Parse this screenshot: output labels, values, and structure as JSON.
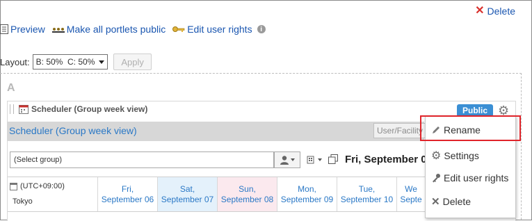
{
  "top_actions": {
    "delete_label": "Delete"
  },
  "toolbar": {
    "preview_label": "Preview",
    "make_public_label": "Make all portlets public",
    "edit_rights_label": "Edit user rights"
  },
  "layout": {
    "label": "Layout:",
    "select_value": "B: 50%  C: 50%",
    "apply_label": "Apply"
  },
  "zone": {
    "label": "A"
  },
  "portlet": {
    "header_title": "Scheduler (Group week view)",
    "public_badge": "Public",
    "title_link": "Scheduler (Group week view)",
    "user_facility": "User/Facility",
    "group_select": "(Select group)",
    "date_title": "Fri, September 0",
    "timezone": "(UTC+09:00)",
    "city": "Tokyo",
    "days": [
      {
        "line1": "Fri,",
        "line2": "September 06",
        "bg": "#ffffff"
      },
      {
        "line1": "Sat,",
        "line2": "September 07",
        "bg": "#e4f1fb"
      },
      {
        "line1": "Sun,",
        "line2": "September 08",
        "bg": "#fbe9ee"
      },
      {
        "line1": "Mon,",
        "line2": "September 09",
        "bg": "#ffffff"
      },
      {
        "line1": "Tue,",
        "line2": "September 10",
        "bg": "#ffffff"
      },
      {
        "line1": "We",
        "line2": "Septe",
        "bg": "#ffffff"
      }
    ]
  },
  "context_menu": {
    "items": [
      {
        "label": "Rename",
        "icon": "pencil-icon"
      },
      {
        "label": "Settings",
        "icon": "gear-icon"
      },
      {
        "label": "Edit user rights",
        "icon": "key-icon"
      },
      {
        "label": "Delete",
        "icon": "close-icon"
      }
    ]
  },
  "colors": {
    "link": "#1a56b0",
    "public_badge": "#3b8fd4",
    "highlight_box": "#e0242a"
  }
}
